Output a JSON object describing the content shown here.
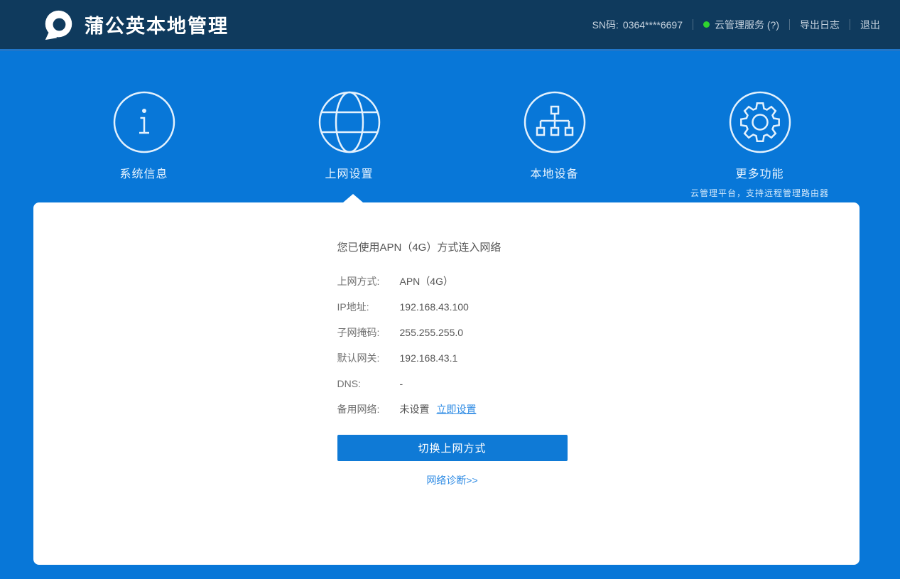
{
  "header": {
    "title": "蒲公英本地管理",
    "sn_label": "SN码:",
    "sn_value": "0364****6697",
    "cloud_service": "云管理服务 (?)",
    "export_log": "导出日志",
    "logout": "退出"
  },
  "tabs": [
    {
      "label": "系统信息",
      "icon": "info-icon",
      "active": false
    },
    {
      "label": "上网设置",
      "icon": "globe-icon",
      "active": true
    },
    {
      "label": "本地设备",
      "icon": "topology-icon",
      "active": false
    },
    {
      "label": "更多功能",
      "icon": "gear-icon",
      "active": false,
      "subtitle": "云管理平台，支持远程管理路由器"
    }
  ],
  "panel": {
    "status_title": "您已使用APN（4G）方式连入网络",
    "rows": [
      {
        "label": "上网方式:",
        "value": "APN（4G）"
      },
      {
        "label": "IP地址:",
        "value": "192.168.43.100"
      },
      {
        "label": "子网掩码:",
        "value": "255.255.255.0"
      },
      {
        "label": "默认网关:",
        "value": "192.168.43.1"
      },
      {
        "label": "DNS:",
        "value": "-"
      },
      {
        "label": "备用网络:",
        "value": "未设置",
        "link": "立即设置"
      }
    ],
    "switch_button": "切换上网方式",
    "diagnose_link": "网络诊断>>"
  },
  "colors": {
    "header_bg": "#0f3a5d",
    "page_bg": "#0877d8",
    "button_blue": "#0f7ad6",
    "link_blue": "#2e8be4",
    "status_green": "#2fd32f"
  }
}
